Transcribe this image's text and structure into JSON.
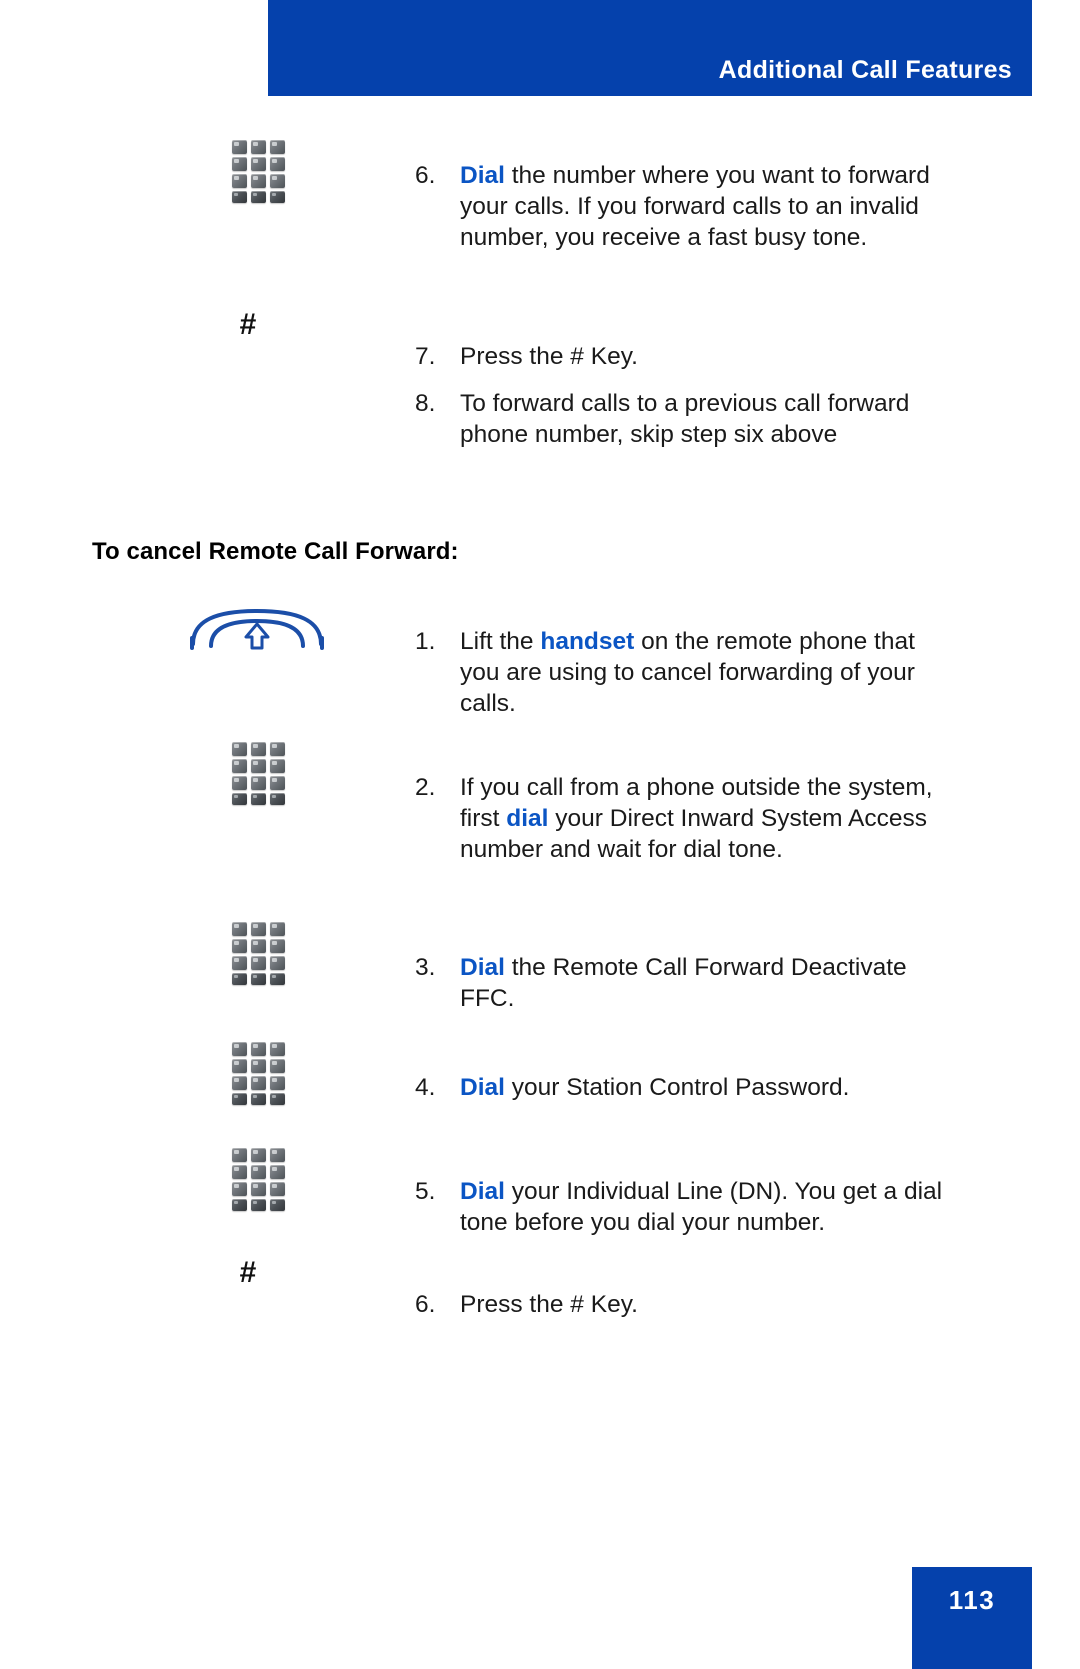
{
  "header": {
    "title": "Additional Call Features",
    "background_color": "#0541AC"
  },
  "accent_color": "#0B55C4",
  "section": {
    "heading": "To cancel Remote Call Forward:"
  },
  "steps_top": [
    {
      "number": "6.",
      "icon": "keypad-icon",
      "accent_word": "Dial",
      "text_after": " the number where you want to forward your calls. If you forward calls to an invalid number, you receive a fast busy tone."
    },
    {
      "number": "7.",
      "icon": "hash-key-icon",
      "accent_word": "",
      "text_after": "Press the # Key."
    },
    {
      "number": "8.",
      "icon": "",
      "accent_word": "",
      "text_after": "To forward calls to a previous call forward phone number, skip step six above"
    }
  ],
  "steps_bottom": [
    {
      "number": "1.",
      "icon": "handset-icon",
      "text_before": "Lift the ",
      "accent_word": "handset",
      "text_after": " on the remote phone that you are using to cancel forwarding of your calls."
    },
    {
      "number": "2.",
      "icon": "keypad-icon",
      "text_before": "If you call from a phone outside the system, first ",
      "accent_word": "dial",
      "text_after": " your Direct Inward System Access number and wait for dial tone."
    },
    {
      "number": "3.",
      "icon": "keypad-icon",
      "text_before": "",
      "accent_word": "Dial",
      "text_after": " the Remote Call Forward Deactivate FFC."
    },
    {
      "number": "4.",
      "icon": "keypad-icon",
      "text_before": "",
      "accent_word": "Dial",
      "text_after": " your Station Control Password."
    },
    {
      "number": "5.",
      "icon": "keypad-icon",
      "text_before": "",
      "accent_word": "Dial",
      "text_after": " your Individual Line (DN). You get a dial tone before you dial your number."
    },
    {
      "number": "6.",
      "icon": "hash-key-icon",
      "text_before": "",
      "accent_word": "",
      "text_after": "Press the # Key."
    }
  ],
  "icons": {
    "hash_glyph": "#"
  },
  "footer": {
    "page_number": "113",
    "background_color": "#0541AC"
  }
}
